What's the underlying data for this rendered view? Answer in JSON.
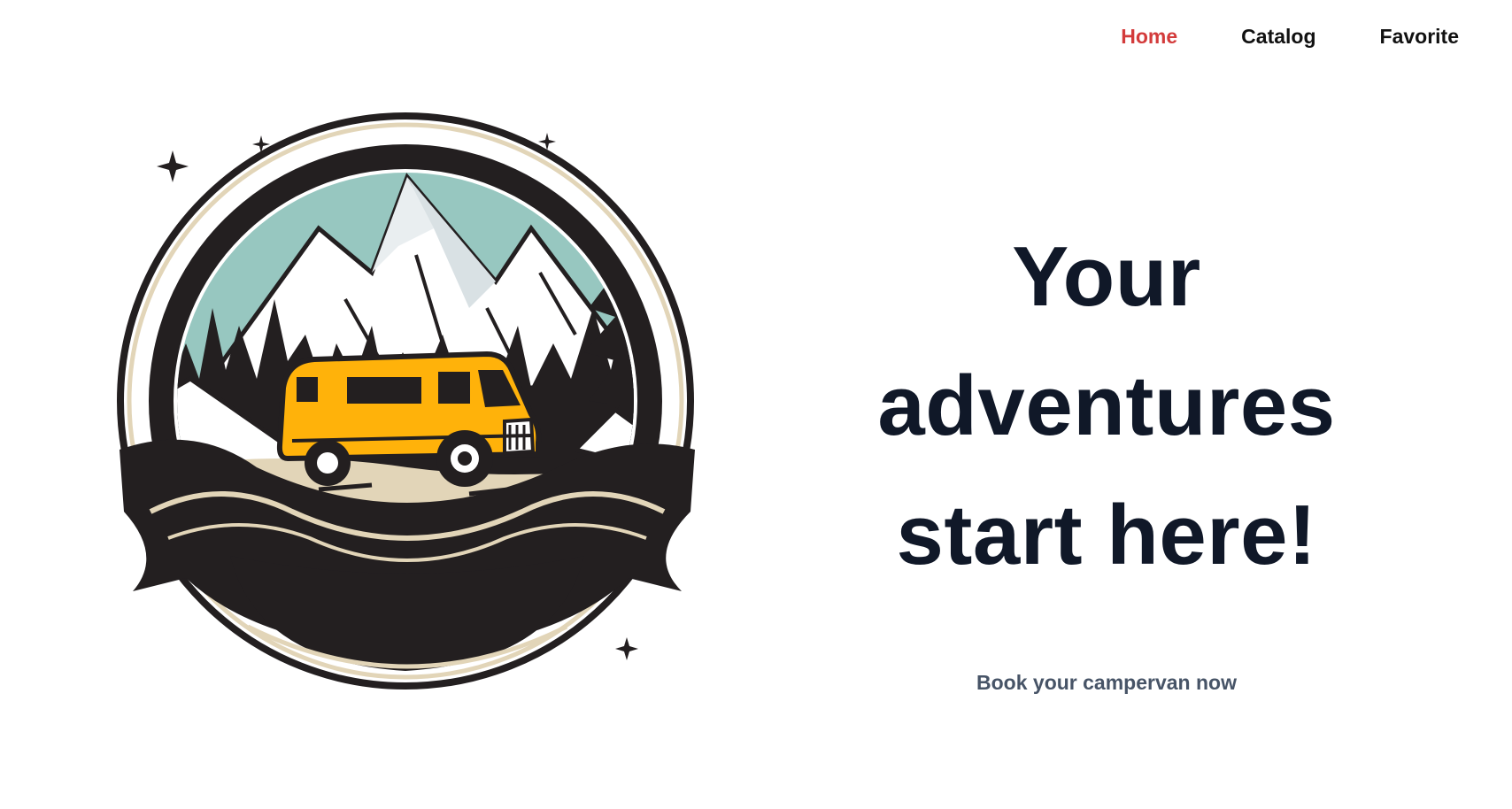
{
  "nav": {
    "items": [
      {
        "label": "Home",
        "active": true
      },
      {
        "label": "Catalog",
        "active": false
      },
      {
        "label": "Favorite",
        "active": false
      }
    ]
  },
  "hero": {
    "title_line1": "Your",
    "title_line2": "adventures",
    "title_line3": "start here!",
    "subtitle": "Book your campervan now"
  },
  "colors": {
    "accent": "#d33b3b",
    "title": "#101828",
    "subtitle": "#475467",
    "van": "#ffb20a",
    "sky": "#97c7c0",
    "dark": "#231f20",
    "sand": "#e2d5b8"
  },
  "logo": {
    "icon": "campervan-mountain-logo"
  }
}
